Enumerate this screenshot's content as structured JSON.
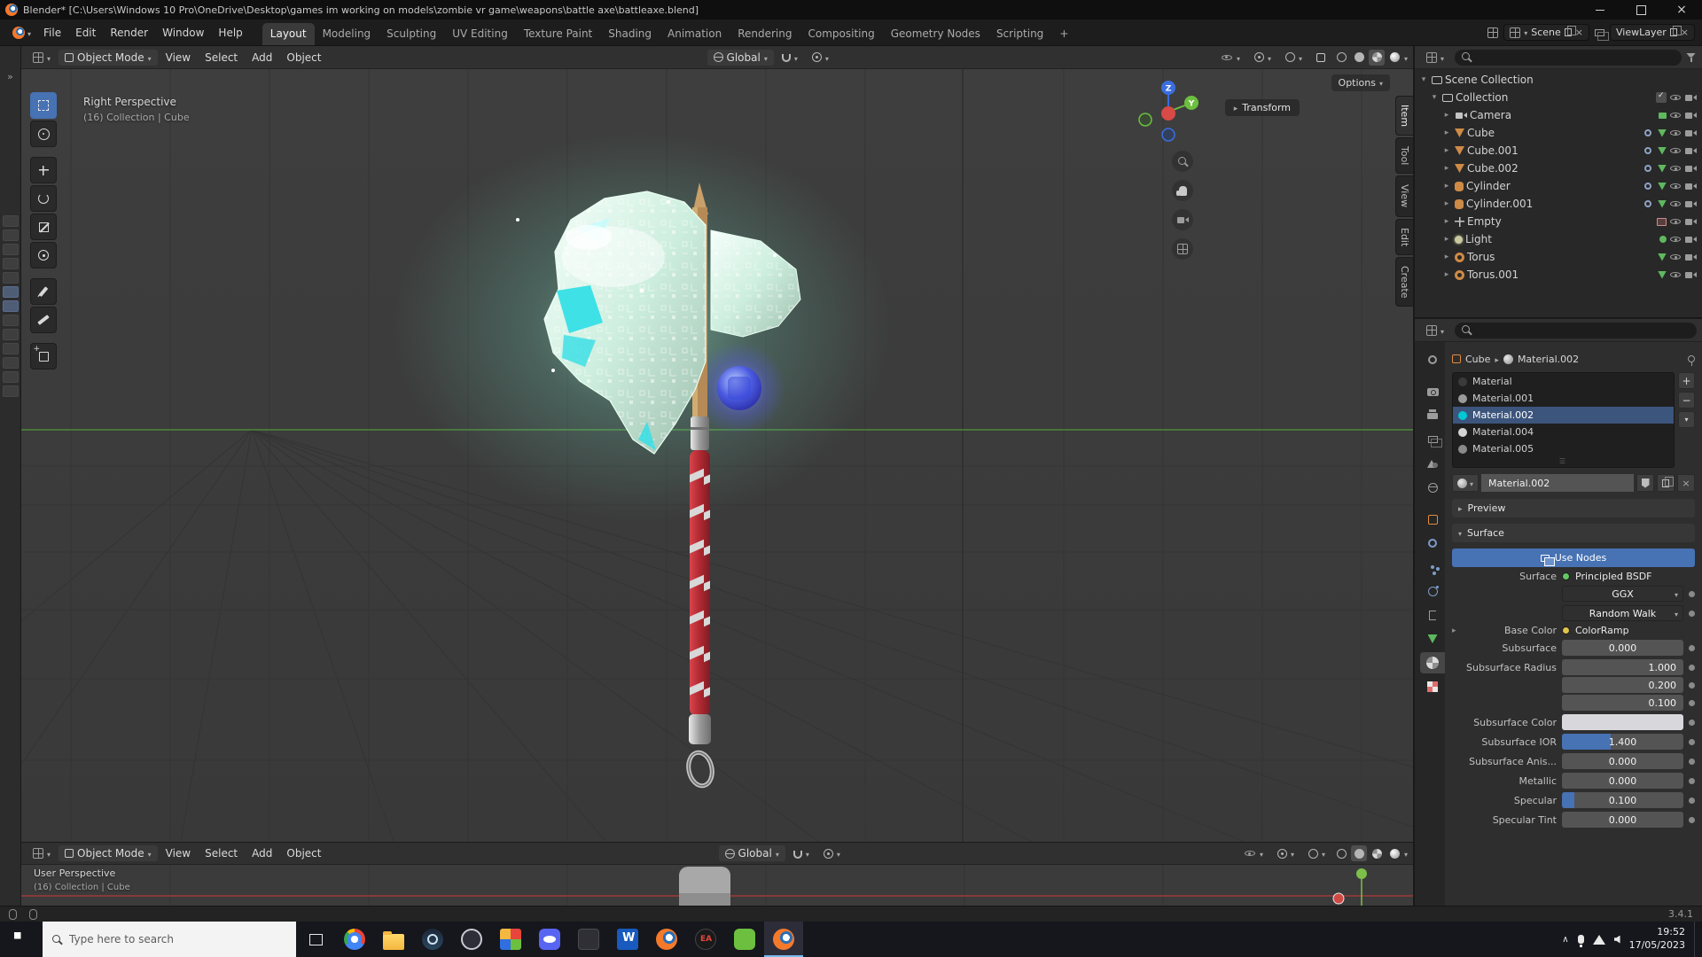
{
  "titlebar": {
    "title": "Blender* [C:\\Users\\Windows 10 Pro\\OneDrive\\Desktop\\games im working on models\\zombie vr game\\weapons\\battle axe\\battleaxe.blend]"
  },
  "topbar": {
    "menus": [
      "File",
      "Edit",
      "Render",
      "Window",
      "Help"
    ],
    "workspaces": [
      "Layout",
      "Modeling",
      "Sculpting",
      "UV Editing",
      "Texture Paint",
      "Shading",
      "Animation",
      "Rendering",
      "Compositing",
      "Geometry Nodes",
      "Scripting",
      "+"
    ],
    "scene": "Scene",
    "viewlayer": "ViewLayer"
  },
  "viewport": {
    "mode": "Object Mode",
    "menus": [
      "View",
      "Select",
      "Add",
      "Object"
    ],
    "orientation": "Global",
    "options": "Options",
    "view_label": "Right Perspective",
    "context_label": "(16) Collection | Cube",
    "transform_panel": "Transform",
    "sidebar_tabs": [
      "Item",
      "Tool",
      "View",
      "Edit",
      "Create"
    ],
    "gizmo": {
      "z": "Z",
      "y": "Y"
    }
  },
  "viewport2": {
    "mode": "Object Mode",
    "menus": [
      "View",
      "Select",
      "Add",
      "Object"
    ],
    "orientation": "Global",
    "view_label": "User Perspective",
    "context_label": "(16) Collection | Cube"
  },
  "outliner": {
    "rows": [
      {
        "name": "Scene Collection"
      },
      {
        "name": "Collection"
      },
      {
        "name": "Camera"
      },
      {
        "name": "Cube"
      },
      {
        "name": "Cube.001"
      },
      {
        "name": "Cube.002"
      },
      {
        "name": "Cylinder"
      },
      {
        "name": "Cylin­der.001"
      },
      {
        "name": "Empty"
      },
      {
        "name": "Light"
      },
      {
        "name": "Torus"
      },
      {
        "name": "Torus.001"
      }
    ]
  },
  "properties": {
    "breadcrumb": {
      "object": "Cube",
      "material": "Material.002"
    },
    "slots": [
      "Material",
      "Material.001",
      "Material.002",
      "Material.004",
      "Material.005"
    ],
    "name_field": "Material.002",
    "preview_panel": "Preview",
    "surface_panel": "Surface",
    "use_nodes": "Use Nodes",
    "surface_label": "Surface",
    "surface_value": "Principled BSDF",
    "distribution": "GGX",
    "sss_method": "Random Walk",
    "base_color_label": "Base Color",
    "base_color_value": "ColorRamp",
    "rows": [
      {
        "label": "Subsurface",
        "value": "0.000"
      },
      {
        "label": "Subsurface Radius",
        "value": "1.000"
      },
      {
        "label": "",
        "value": "0.200"
      },
      {
        "label": "",
        "value": "0.100"
      },
      {
        "label": "Subsurface Color",
        "value": ""
      },
      {
        "label": "Subsurface IOR",
        "value": "1.400"
      },
      {
        "label": "Subsurface Anis...",
        "value": "0.000"
      },
      {
        "label": "Metallic",
        "value": "0.000"
      },
      {
        "label": "Specular",
        "value": "0.100"
      },
      {
        "label": "Specular Tint",
        "value": "0.000"
      }
    ]
  },
  "statusbar": {
    "version": "3.4.1"
  },
  "taskbar": {
    "search_placeholder": "Type here to search",
    "time": "19:52",
    "date": "17/05/2023"
  },
  "colors": {
    "accent": "#4772b3",
    "mesh_icon": "#cf8a45",
    "material_active": "#00c8d4",
    "axis_x": "#d84a45",
    "axis_y": "#6cbf3f",
    "axis_z": "#3b6fe0"
  }
}
